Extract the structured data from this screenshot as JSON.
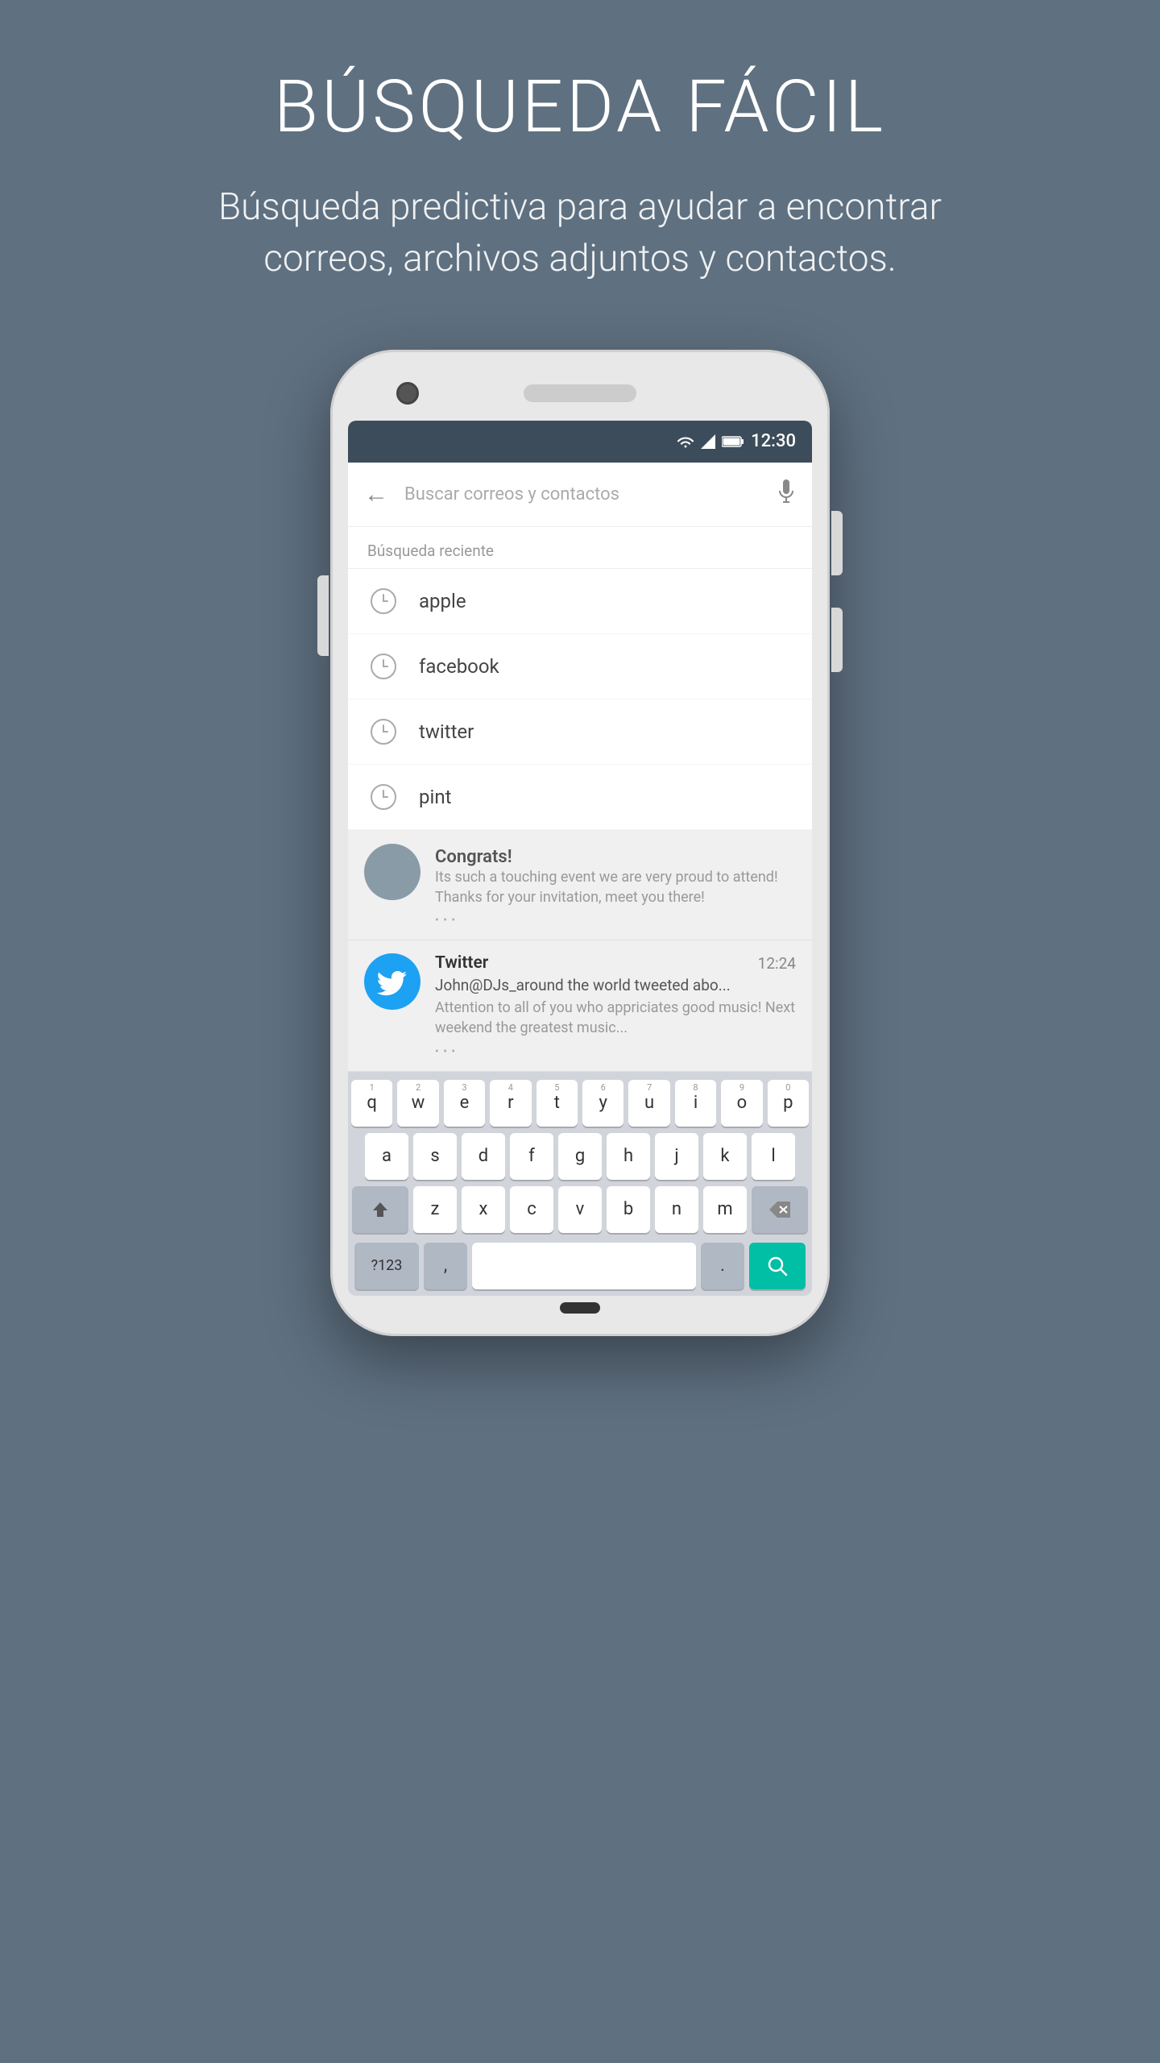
{
  "page": {
    "background_color": "#5f7080",
    "title": "BÚSQUEDA FÁCIL",
    "subtitle": "Búsqueda predictiva para ayudar a encontrar correos, archivos adjuntos y contactos."
  },
  "status_bar": {
    "time": "12:30"
  },
  "search_bar": {
    "placeholder": "Buscar correos y contactos"
  },
  "recent_section": {
    "header": "Búsqueda reciente",
    "items": [
      {
        "label": "apple"
      },
      {
        "label": "facebook"
      },
      {
        "label": "twitter"
      },
      {
        "label": "pint"
      }
    ]
  },
  "email_items": [
    {
      "sender": "Congrats!",
      "preview": "Its such a touching event we are very proud to attend! Thanks for your invitation, meet you there!"
    },
    {
      "sender": "Twitter",
      "time": "12:24",
      "subject": "John@DJs_around the world tweeted abo...",
      "preview": "Attention to all of you who appriciates good music! Next weekend the greatest music..."
    }
  ],
  "keyboard": {
    "rows": [
      [
        "q",
        "w",
        "e",
        "r",
        "t",
        "y",
        "u",
        "i",
        "o",
        "p"
      ],
      [
        "a",
        "s",
        "d",
        "f",
        "g",
        "h",
        "j",
        "k",
        "l"
      ],
      [
        "z",
        "x",
        "c",
        "v",
        "b",
        "n",
        "m"
      ]
    ],
    "numbers": [
      "1",
      "2",
      "3",
      "4",
      "5",
      "6",
      "7",
      "8",
      "9",
      "0"
    ],
    "special_keys": {
      "shift": "⬆",
      "delete": "⌫",
      "numbers_toggle": "?123",
      "comma": ",",
      "period": ".",
      "search_icon": "🔍"
    }
  }
}
